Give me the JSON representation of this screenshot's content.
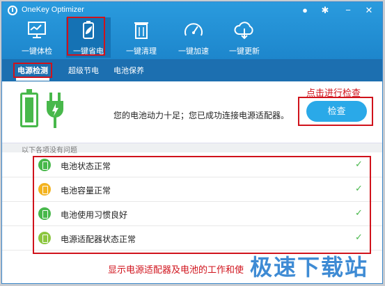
{
  "window": {
    "title": "OneKey Optimizer"
  },
  "titlebar_buttons": [
    {
      "icon": "feedback-icon",
      "glyph": "●"
    },
    {
      "icon": "gear-icon",
      "glyph": "✱"
    },
    {
      "icon": "minimize-icon",
      "glyph": "−"
    },
    {
      "icon": "close-icon",
      "glyph": "✕"
    }
  ],
  "nav": [
    {
      "label": "一键体检",
      "icon": "monitor-icon"
    },
    {
      "label": "一键省电",
      "icon": "battery-leaf-icon"
    },
    {
      "label": "一键清理",
      "icon": "trash-icon"
    },
    {
      "label": "一键加速",
      "icon": "speedometer-icon"
    },
    {
      "label": "一键更新",
      "icon": "cloud-download-icon"
    }
  ],
  "subtabs": [
    "电源检测",
    "超级节电",
    "电池保养"
  ],
  "status": {
    "message": "您的电池动力十足；您已成功连接电源适配器。"
  },
  "hint": "点击进行检查",
  "check_button": "检查",
  "section_label": "以下各项没有问题",
  "checks": [
    {
      "label": "电池状态正常",
      "color": "#48b84b",
      "icon": "battery-icon"
    },
    {
      "label": "电池容量正常",
      "color": "#f3b320",
      "icon": "pie-icon"
    },
    {
      "label": "电池使用习惯良好",
      "color": "#48b84b",
      "icon": "infinity-icon"
    },
    {
      "label": "电源适配器状态正常",
      "color": "#8cc63f",
      "icon": "plug-icon"
    }
  ],
  "caption": "显示电源适配器及电池的工作和使",
  "watermark": "极速下载站",
  "colors": {
    "accent": "#2a9bde",
    "highlight": "#d0121b",
    "ok": "#48b84b"
  }
}
